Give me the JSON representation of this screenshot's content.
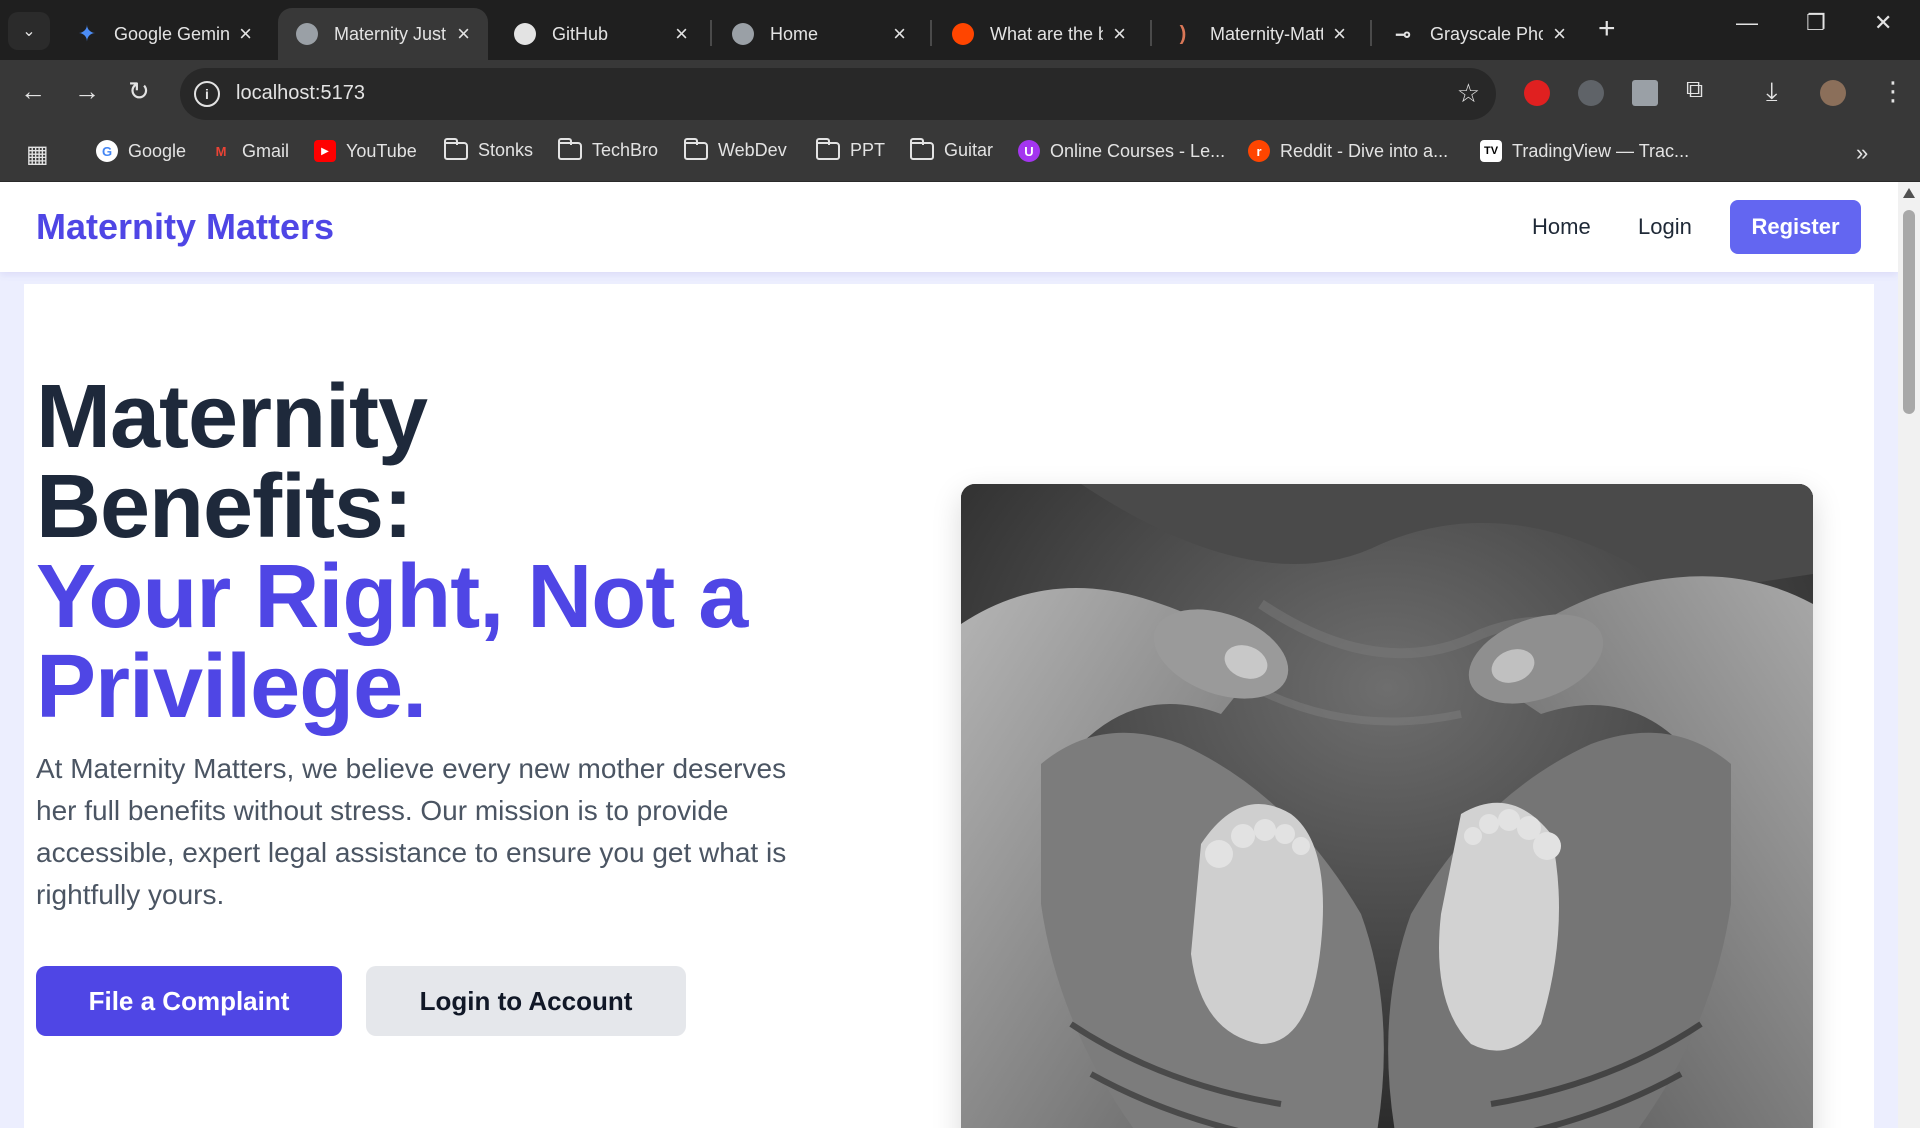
{
  "browser": {
    "tabs": [
      {
        "title": "Google Gemini",
        "favicon": "gemini-icon"
      },
      {
        "title": "Maternity Justice",
        "favicon": "globe-icon"
      },
      {
        "title": "GitHub",
        "favicon": "github-icon"
      },
      {
        "title": "Home",
        "favicon": "globe-icon"
      },
      {
        "title": "What are the best",
        "favicon": "reddit-icon"
      },
      {
        "title": "Maternity-Matters",
        "favicon": "claude-icon"
      },
      {
        "title": "Grayscale Photos",
        "favicon": "pexels-icon"
      }
    ],
    "url": "localhost:5173",
    "bookmarks": [
      {
        "label": "Google",
        "icon": "google-icon"
      },
      {
        "label": "Gmail",
        "icon": "gmail-icon"
      },
      {
        "label": "YouTube",
        "icon": "youtube-icon"
      },
      {
        "label": "Stonks",
        "icon": "folder-icon"
      },
      {
        "label": "TechBro",
        "icon": "folder-icon"
      },
      {
        "label": "WebDev",
        "icon": "folder-icon"
      },
      {
        "label": "PPT",
        "icon": "folder-icon"
      },
      {
        "label": "Guitar",
        "icon": "folder-icon"
      },
      {
        "label": "Online Courses - Le...",
        "icon": "udemy-icon"
      },
      {
        "label": "Reddit - Dive into a...",
        "icon": "reddit-icon"
      },
      {
        "label": "TradingView — Trac...",
        "icon": "tradingview-icon"
      }
    ]
  },
  "site": {
    "brand": "Maternity Matters",
    "nav": {
      "home": "Home",
      "login": "Login",
      "register": "Register"
    },
    "hero": {
      "title_line1": "Maternity",
      "title_line2": "Benefits:",
      "accent_line1": "Your Right, Not a",
      "accent_line2": "Privilege.",
      "lead": "At Maternity Matters, we believe every new mother deserves her full benefits without stress. Our mission is to provide accessible, expert legal assistance to ensure you get what is rightfully yours.",
      "primary_cta": "File a Complaint",
      "secondary_cta": "Login to Account",
      "image": "black-and-white photo of adult hands cradling a baby's feet in a heart shape"
    }
  },
  "colors": {
    "accent": "#4f46e5",
    "register": "#6366f1",
    "heading": "#1e293b",
    "body": "#4b5563"
  }
}
